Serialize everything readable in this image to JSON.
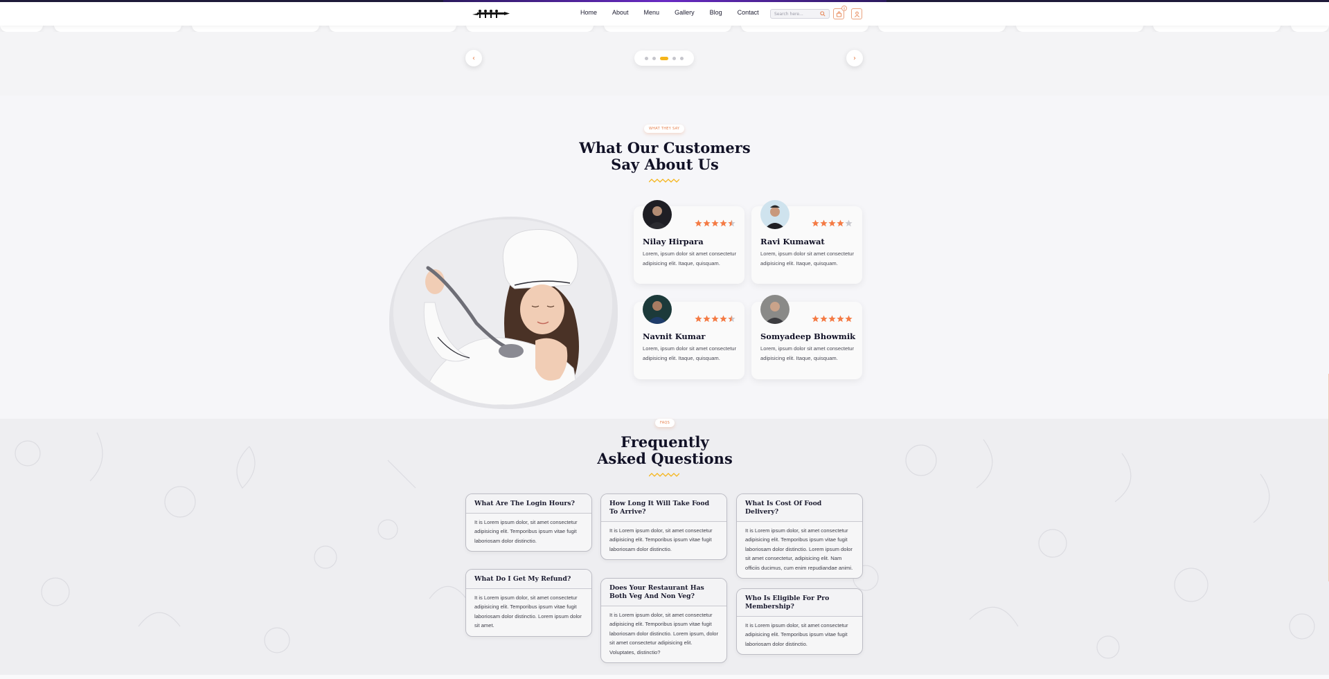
{
  "nav": {
    "links": [
      "Home",
      "About",
      "Menu",
      "Gallery",
      "Blog",
      "Contact"
    ],
    "search_placeholder": "Search here...",
    "cart_count": "0"
  },
  "slider": {
    "dots": 5,
    "active_dot": 3
  },
  "testimonials": {
    "tag": "WHAT THEY SAY",
    "title_line1": "What Our Customers",
    "title_line2": "Say About Us",
    "items": [
      {
        "name": "Nilay Hirpara",
        "rating": 4.5,
        "text": "Lorem, ipsum dolor sit amet consectetur adipisicing elit. Itaque, quisquam."
      },
      {
        "name": "Ravi Kumawat",
        "rating": 4,
        "text": "Lorem, ipsum dolor sit amet consectetur adipisicing elit. Itaque, quisquam."
      },
      {
        "name": "Navnit Kumar",
        "rating": 4.5,
        "text": "Lorem, ipsum dolor sit amet consectetur adipisicing elit. Itaque, quisquam."
      },
      {
        "name": "Somyadeep Bhowmik",
        "rating": 5,
        "text": "Lorem, ipsum dolor sit amet consectetur adipisicing elit. Itaque, quisquam."
      }
    ]
  },
  "faq": {
    "tag": "FAQS",
    "title_line1": "Frequently",
    "title_line2": "Asked Questions",
    "items": [
      {
        "q": "What Are The Login Hours?",
        "a": "It is Lorem ipsum dolor, sit amet consectetur adipisicing elit. Temporibus ipsum vitae fugit laboriosam dolor distinctio."
      },
      {
        "q": "What Do I Get My Refund?",
        "a": "It is Lorem ipsum dolor, sit amet consectetur adipisicing elit. Temporibus ipsum vitae fugit laboriosam dolor distinctio. Lorem ipsum dolor sit amet."
      },
      {
        "q": "How Long It Will Take Food To Arrive?",
        "a": "It is Lorem ipsum dolor, sit amet consectetur adipisicing elit. Temporibus ipsum vitae fugit laboriosam dolor distinctio."
      },
      {
        "q": "Does Your Restaurant Has Both Veg And Non Veg?",
        "a": "It is Lorem ipsum dolor, sit amet consectetur adipisicing elit. Temporibus ipsum vitae fugit laboriosam dolor distinctio. Lorem ipsum, dolor sit amet consectetur adipisicing elit. Voluptates, distinctio?"
      },
      {
        "q": "What Is Cost Of Food Delivery?",
        "a": "It is Lorem ipsum dolor, sit amet consectetur adipisicing elit. Temporibus ipsum vitae fugit laboriosam dolor distinctio. Lorem ipsum dolor sit amet consectetur, adipisicing elit. Nam officiis ducimus, cum enim repudiandae animi."
      },
      {
        "q": "Who Is Eligible For Pro Membership?",
        "a": "It is Lorem ipsum dolor, sit amet consectetur adipisicing elit. Temporibus ipsum vitae fugit laboriosam dolor distinctio."
      }
    ]
  },
  "colors": {
    "accent": "#e67e4a",
    "star": "#f47b45",
    "star_empty": "#c9c9cf",
    "dot_active": "#f5b51b",
    "heading": "#111126"
  }
}
